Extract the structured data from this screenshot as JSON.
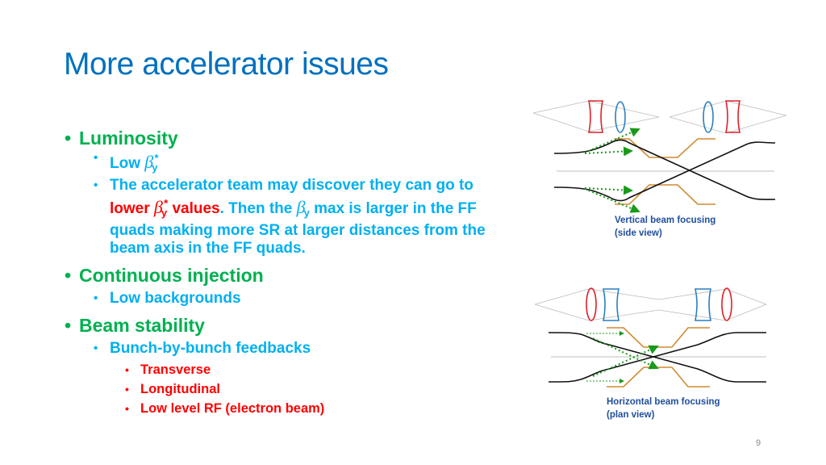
{
  "title": "More accelerator issues",
  "bullets": {
    "luminosity": {
      "label": "Luminosity",
      "low_beta": {
        "prefix": "Low ",
        "beta": "β",
        "sub": "y",
        "sup": "*"
      },
      "team": {
        "line1": "The accelerator team may discover they can go to",
        "red_lower": "lower ",
        "beta": "β",
        "sub": "y",
        "sup": "*",
        "red_values": " values",
        "after_red": ". Then the ",
        "beta2": "β",
        "sub2": "y",
        "rest1": " max is larger in the FF",
        "line3": "quads making more SR at larger distances from the",
        "line4": "beam axis in the FF quads."
      }
    },
    "injection": {
      "label": "Continuous injection",
      "sub": "Low backgrounds"
    },
    "stability": {
      "label": "Beam stability",
      "sub": "Bunch-by-bunch feedbacks",
      "items": [
        "Transverse",
        "Longitudinal",
        "Low level RF (electron beam)"
      ]
    }
  },
  "diagrams": {
    "vertical": {
      "caption1": "Vertical beam focusing",
      "caption2": "(side view)"
    },
    "horizontal": {
      "caption1": "Horizontal beam focusing",
      "caption2": "(plan view)"
    }
  },
  "colors": {
    "title": "#0070c0",
    "level1": "#00b050",
    "level2": "#00b0f0",
    "level3": "#ff0000"
  },
  "page_number": "9"
}
